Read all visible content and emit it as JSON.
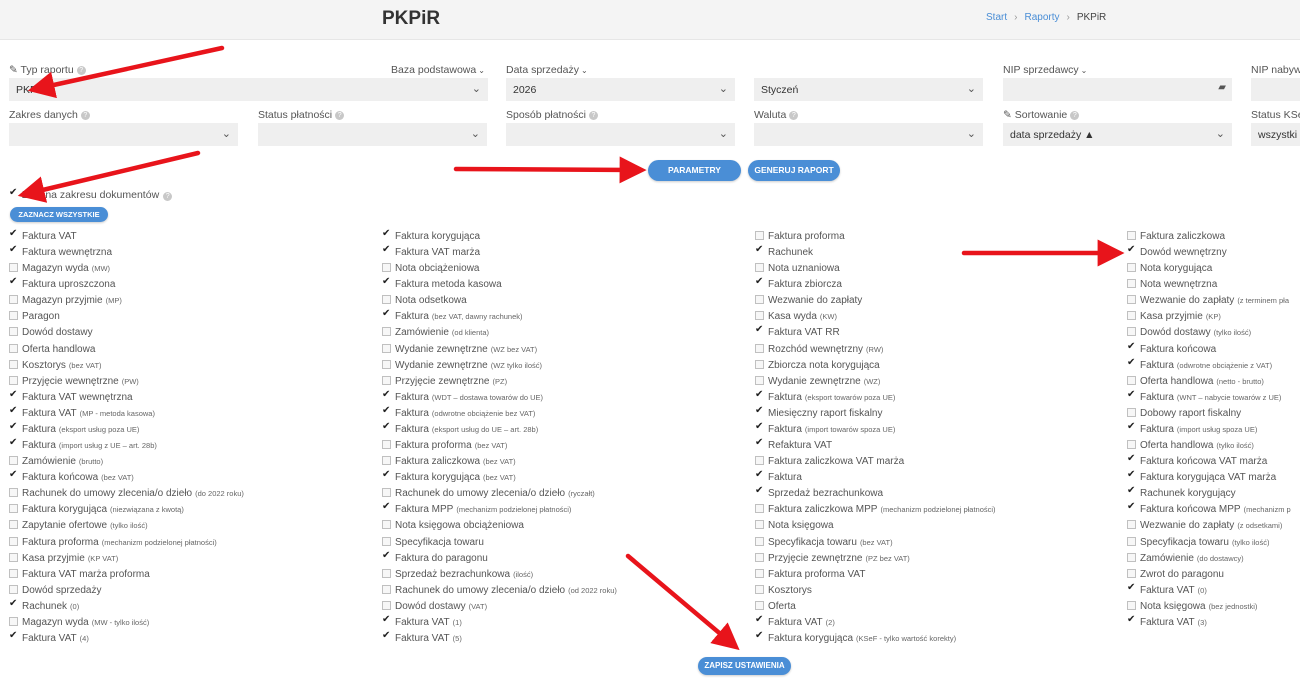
{
  "header": {
    "title": "PKPiR",
    "breadcrumb": [
      "Start",
      "Raporty",
      "PKPiR"
    ]
  },
  "filters": {
    "typ_raportu": {
      "label": "Typ raportu",
      "value": "PKPIR"
    },
    "baza": {
      "label": "Baza podstawowa"
    },
    "data_sprzedazy": {
      "label": "Data sprzedaży",
      "value_year": "2026",
      "value_month": "Styczeń"
    },
    "nip_sprzedawcy": {
      "label": "NIP sprzedawcy",
      "value": ""
    },
    "nip_nabywcy": {
      "label": "NIP nabyw"
    },
    "zakres_danych": {
      "label": "Zakres danych",
      "value": ""
    },
    "status_platnosci": {
      "label": "Status płatności",
      "value": ""
    },
    "sposob_platnosci": {
      "label": "Sposób płatności",
      "value": ""
    },
    "waluta": {
      "label": "Waluta",
      "value": ""
    },
    "sortowanie": {
      "label": "Sortowanie",
      "value": "data sprzedaży ▲"
    },
    "status_ksef": {
      "label": "Status KSe",
      "value": "wszystki"
    }
  },
  "buttons": {
    "parametry": "PARAMETRY",
    "generuj": "GENERUJ RAPORT",
    "zaznacz": "ZAZNACZ WSZYSTKIE",
    "zapisz": "ZAPISZ USTAWIENIA"
  },
  "zmiana": {
    "label": "Zmiana zakresu dokumentów",
    "checked": true
  },
  "columns": [
    [
      {
        "t": "Faktura VAT",
        "s": "",
        "c": true
      },
      {
        "t": "Faktura wewnętrzna",
        "s": "",
        "c": true
      },
      {
        "t": "Magazyn wyda",
        "s": "(MW)",
        "c": false
      },
      {
        "t": "Faktura uproszczona",
        "s": "",
        "c": true
      },
      {
        "t": "Magazyn przyjmie",
        "s": "(MP)",
        "c": false
      },
      {
        "t": "Paragon",
        "s": "",
        "c": false
      },
      {
        "t": "Dowód dostawy",
        "s": "",
        "c": false
      },
      {
        "t": "Oferta handlowa",
        "s": "",
        "c": false
      },
      {
        "t": "Kosztorys",
        "s": "(bez VAT)",
        "c": false
      },
      {
        "t": "Przyjęcie wewnętrzne",
        "s": "(PW)",
        "c": false
      },
      {
        "t": "Faktura VAT wewnętrzna",
        "s": "",
        "c": true
      },
      {
        "t": "Faktura VAT",
        "s": "(MP - metoda kasowa)",
        "c": true
      },
      {
        "t": "Faktura",
        "s": "(eksport usług poza UE)",
        "c": true
      },
      {
        "t": "Faktura",
        "s": "(import usług z UE – art. 28b)",
        "c": true
      },
      {
        "t": "Zamówienie",
        "s": "(brutto)",
        "c": false
      },
      {
        "t": "Faktura końcowa",
        "s": "(bez VAT)",
        "c": true
      },
      {
        "t": "Rachunek do umowy zlecenia/o dzieło",
        "s": "(do 2022 roku)",
        "c": false
      },
      {
        "t": "Faktura korygująca",
        "s": "(niezwiązana z kwotą)",
        "c": false
      },
      {
        "t": "Zapytanie ofertowe",
        "s": "(tylko ilość)",
        "c": false
      },
      {
        "t": "Faktura proforma",
        "s": "(mechanizm podzielonej płatności)",
        "c": false
      },
      {
        "t": "Kasa przyjmie",
        "s": "(KP VAT)",
        "c": false
      },
      {
        "t": "Faktura VAT marża proforma",
        "s": "",
        "c": false
      },
      {
        "t": "Dowód sprzedaży",
        "s": "",
        "c": false
      },
      {
        "t": "Rachunek",
        "s": "(0)",
        "c": true
      },
      {
        "t": "Magazyn wyda",
        "s": "(MW - tylko ilość)",
        "c": false
      },
      {
        "t": "Faktura VAT",
        "s": "(4)",
        "c": true
      }
    ],
    [
      {
        "t": "Faktura korygująca",
        "s": "",
        "c": true
      },
      {
        "t": "Faktura VAT marża",
        "s": "",
        "c": true
      },
      {
        "t": "Nota obciążeniowa",
        "s": "",
        "c": false
      },
      {
        "t": "Faktura metoda kasowa",
        "s": "",
        "c": true
      },
      {
        "t": "Nota odsetkowa",
        "s": "",
        "c": false
      },
      {
        "t": "Faktura",
        "s": "(bez VAT, dawny rachunek)",
        "c": true
      },
      {
        "t": "Zamówienie",
        "s": "(od klienta)",
        "c": false
      },
      {
        "t": "Wydanie zewnętrzne",
        "s": "(WZ bez VAT)",
        "c": false
      },
      {
        "t": "Wydanie zewnętrzne",
        "s": "(WZ tylko ilość)",
        "c": false
      },
      {
        "t": "Przyjęcie zewnętrzne",
        "s": "(PZ)",
        "c": false
      },
      {
        "t": "Faktura",
        "s": "(WDT – dostawa towarów do UE)",
        "c": true
      },
      {
        "t": "Faktura",
        "s": "(odwrotne obciążenie bez VAT)",
        "c": true
      },
      {
        "t": "Faktura",
        "s": "(eksport usług do UE – art. 28b)",
        "c": true
      },
      {
        "t": "Faktura proforma",
        "s": "(bez VAT)",
        "c": false
      },
      {
        "t": "Faktura zaliczkowa",
        "s": "(bez VAT)",
        "c": false
      },
      {
        "t": "Faktura korygująca",
        "s": "(bez VAT)",
        "c": true
      },
      {
        "t": "Rachunek do umowy zlecenia/o dzieło",
        "s": "(ryczałt)",
        "c": false
      },
      {
        "t": "Faktura MPP",
        "s": "(mechanizm podzielonej płatności)",
        "c": true
      },
      {
        "t": "Nota księgowa obciążeniowa",
        "s": "",
        "c": false
      },
      {
        "t": "Specyfikacja towaru",
        "s": "",
        "c": false
      },
      {
        "t": "Faktura do paragonu",
        "s": "",
        "c": true
      },
      {
        "t": "Sprzedaż bezrachunkowa",
        "s": "(ilość)",
        "c": false
      },
      {
        "t": "Rachunek do umowy zlecenia/o dzieło",
        "s": "(od 2022 roku)",
        "c": false
      },
      {
        "t": "Dowód dostawy",
        "s": "(VAT)",
        "c": false
      },
      {
        "t": "Faktura VAT",
        "s": "(1)",
        "c": true
      },
      {
        "t": "Faktura VAT",
        "s": "(5)",
        "c": true
      }
    ],
    [
      {
        "t": "Faktura proforma",
        "s": "",
        "c": false
      },
      {
        "t": "Rachunek",
        "s": "",
        "c": true
      },
      {
        "t": "Nota uznaniowa",
        "s": "",
        "c": false
      },
      {
        "t": "Faktura zbiorcza",
        "s": "",
        "c": true
      },
      {
        "t": "Wezwanie do zapłaty",
        "s": "",
        "c": false
      },
      {
        "t": "Kasa wyda",
        "s": "(KW)",
        "c": false
      },
      {
        "t": "Faktura VAT RR",
        "s": "",
        "c": true
      },
      {
        "t": "Rozchód wewnętrzny",
        "s": "(RW)",
        "c": false
      },
      {
        "t": "Zbiorcza nota korygująca",
        "s": "",
        "c": false
      },
      {
        "t": "Wydanie zewnętrzne",
        "s": "(WZ)",
        "c": false
      },
      {
        "t": "Faktura",
        "s": "(eksport towarów poza UE)",
        "c": true
      },
      {
        "t": "Miesięczny raport fiskalny",
        "s": "",
        "c": true
      },
      {
        "t": "Faktura",
        "s": "(import towarów spoza UE)",
        "c": true
      },
      {
        "t": "Refaktura VAT",
        "s": "",
        "c": true
      },
      {
        "t": "Faktura zaliczkowa VAT marża",
        "s": "",
        "c": false
      },
      {
        "t": "Faktura",
        "s": "",
        "c": true
      },
      {
        "t": "Sprzedaż bezrachunkowa",
        "s": "",
        "c": true
      },
      {
        "t": "Faktura zaliczkowa MPP",
        "s": "(mechanizm podzielonej płatności)",
        "c": false
      },
      {
        "t": "Nota księgowa",
        "s": "",
        "c": false
      },
      {
        "t": "Specyfikacja towaru",
        "s": "(bez VAT)",
        "c": false
      },
      {
        "t": "Przyjęcie zewnętrzne",
        "s": "(PZ bez VAT)",
        "c": false
      },
      {
        "t": "Faktura proforma VAT",
        "s": "",
        "c": false
      },
      {
        "t": "Kosztorys",
        "s": "",
        "c": false
      },
      {
        "t": "Oferta",
        "s": "",
        "c": false
      },
      {
        "t": "Faktura VAT",
        "s": "(2)",
        "c": true
      },
      {
        "t": "Faktura korygująca",
        "s": "(KSeF - tylko wartość korekty)",
        "c": true
      }
    ],
    [
      {
        "t": "Faktura zaliczkowa",
        "s": "",
        "c": false
      },
      {
        "t": "Dowód wewnętrzny",
        "s": "",
        "c": true
      },
      {
        "t": "Nota korygująca",
        "s": "",
        "c": false
      },
      {
        "t": "Nota wewnętrzna",
        "s": "",
        "c": false
      },
      {
        "t": "Wezwanie do zapłaty",
        "s": "(z terminem pła",
        "c": false
      },
      {
        "t": "Kasa przyjmie",
        "s": "(KP)",
        "c": false
      },
      {
        "t": "Dowód dostawy",
        "s": "(tylko ilość)",
        "c": false
      },
      {
        "t": "Faktura końcowa",
        "s": "",
        "c": true
      },
      {
        "t": "Faktura",
        "s": "(odwrotne obciążenie z VAT)",
        "c": true
      },
      {
        "t": "Oferta handlowa",
        "s": "(netto - brutto)",
        "c": false
      },
      {
        "t": "Faktura",
        "s": "(WNT – nabycie towarów z UE)",
        "c": true
      },
      {
        "t": "Dobowy raport fiskalny",
        "s": "",
        "c": false
      },
      {
        "t": "Faktura",
        "s": "(import usług spoza UE)",
        "c": true
      },
      {
        "t": "Oferta handlowa",
        "s": "(tylko ilość)",
        "c": false
      },
      {
        "t": "Faktura końcowa VAT marża",
        "s": "",
        "c": true
      },
      {
        "t": "Faktura korygująca VAT marża",
        "s": "",
        "c": true
      },
      {
        "t": "Rachunek korygujący",
        "s": "",
        "c": true
      },
      {
        "t": "Faktura końcowa MPP",
        "s": "(mechanizm p",
        "c": true
      },
      {
        "t": "Wezwanie do zapłaty",
        "s": "(z odsetkami)",
        "c": false
      },
      {
        "t": "Specyfikacja towaru",
        "s": "(tylko ilość)",
        "c": false
      },
      {
        "t": "Zamówienie",
        "s": "(do dostawcy)",
        "c": false
      },
      {
        "t": "Zwrot do paragonu",
        "s": "",
        "c": false
      },
      {
        "t": "Faktura VAT",
        "s": "(0)",
        "c": true
      },
      {
        "t": "Nota księgowa",
        "s": "(bez jednostki)",
        "c": false
      },
      {
        "t": "Faktura VAT",
        "s": "(3)",
        "c": true
      }
    ]
  ],
  "colors": {
    "accent": "#4a8ed6",
    "arrow": "#e8141b",
    "topbar": "#f4f4f4",
    "field": "#efefef"
  }
}
